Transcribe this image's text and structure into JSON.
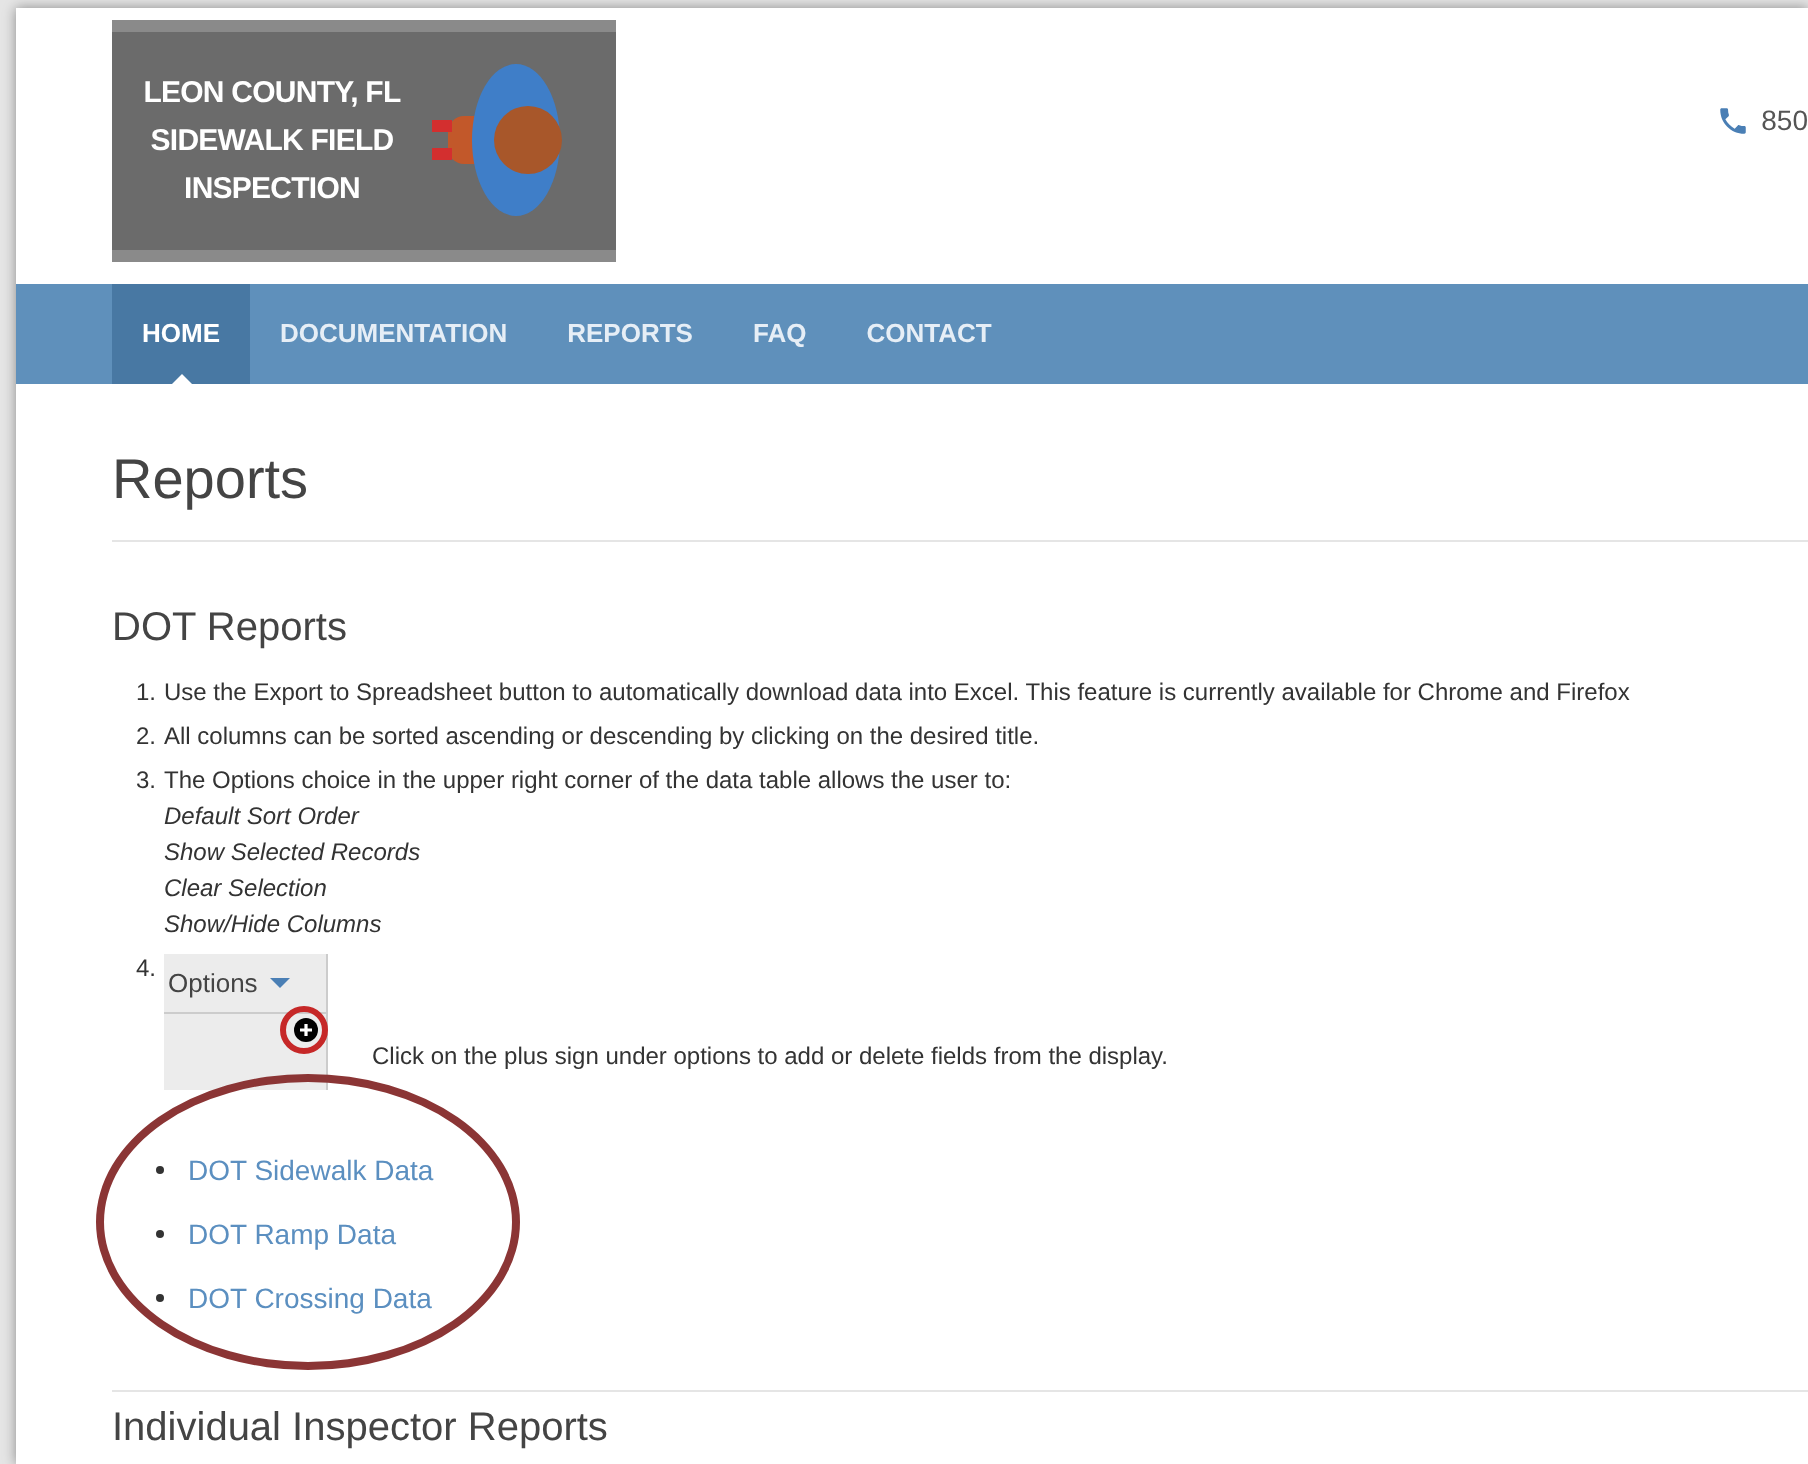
{
  "logo": {
    "lines": [
      "LEON COUNTY, FL",
      "SIDEWALK FIELD",
      "INSPECTION"
    ]
  },
  "phone": "850",
  "nav": [
    {
      "label": "HOME",
      "selected": true
    },
    {
      "label": "DOCUMENTATION",
      "selected": false
    },
    {
      "label": "REPORTS",
      "selected": false
    },
    {
      "label": "FAQ",
      "selected": false
    },
    {
      "label": "CONTACT",
      "selected": false
    }
  ],
  "page_title": "Reports",
  "section_title": "DOT Reports",
  "steps": [
    {
      "number": "1.",
      "text": "Use the Export to Spreadsheet button to automatically download data into Excel. This feature is currently available for Chrome and Firefox"
    },
    {
      "number": "2.",
      "text": "All columns can be sorted ascending or descending by clicking on the desired title."
    },
    {
      "number": "3.",
      "text": "The Options choice in the upper right corner of the data table allows the user to:",
      "options": [
        "Default Sort Order",
        "Show Selected Records",
        "Clear Selection",
        "Show/Hide Columns"
      ]
    },
    {
      "number": "4.",
      "options_label": "Options",
      "text": "Click on the plus sign under options to add or delete fields from the display."
    }
  ],
  "links": [
    "DOT Sidewalk Data",
    "DOT Ramp Data",
    "DOT Crossing Data"
  ],
  "next_section_title": "Individual Inspector Reports"
}
